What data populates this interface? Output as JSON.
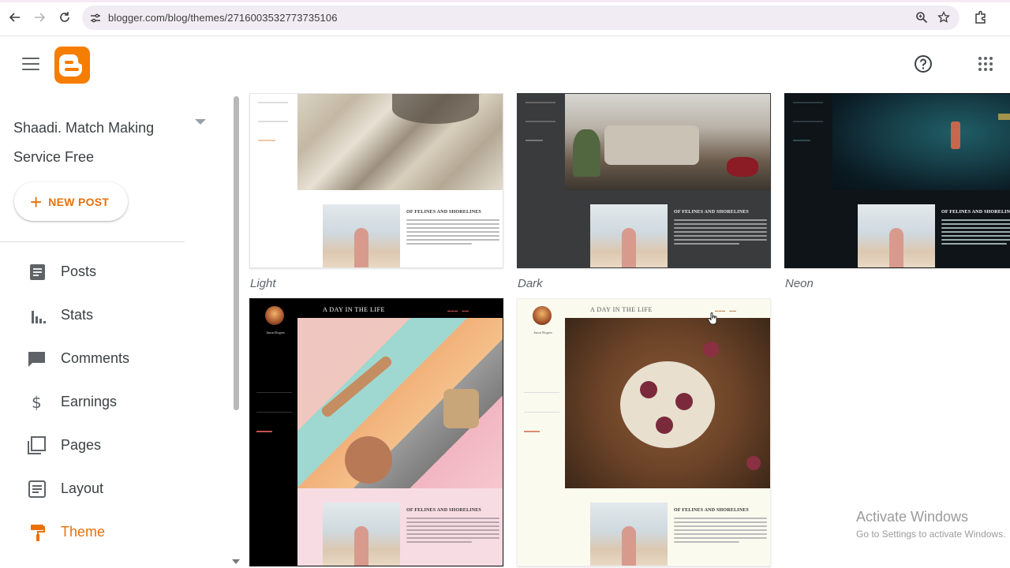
{
  "browser": {
    "url": "blogger.com/blog/themes/2716003532773735106"
  },
  "header": {
    "logo_name": "blogger-logo"
  },
  "sidebar": {
    "blog_name": "Shaadi. Match Making Service Free",
    "new_post_label": "NEW POST",
    "items": [
      {
        "label": "Posts",
        "icon": "posts-icon"
      },
      {
        "label": "Stats",
        "icon": "stats-icon"
      },
      {
        "label": "Comments",
        "icon": "comments-icon"
      },
      {
        "label": "Earnings",
        "icon": "earnings-icon"
      },
      {
        "label": "Pages",
        "icon": "pages-icon"
      },
      {
        "label": "Layout",
        "icon": "layout-icon"
      },
      {
        "label": "Theme",
        "icon": "theme-icon",
        "active": true
      }
    ]
  },
  "themes": [
    {
      "name": "Light"
    },
    {
      "name": "Dark"
    },
    {
      "name": "Neon"
    },
    {
      "name": ""
    },
    {
      "name": ""
    }
  ],
  "card_text": {
    "post_title": "OF FELINES AND SHORELINES",
    "blog_head": "A DAY IN THE LIFE",
    "author": "Jason Rogers"
  },
  "watermark": {
    "line1": "Activate Windows",
    "line2": "Go to Settings to activate Windows."
  },
  "colors": {
    "accent": "#e8710a",
    "blogger_orange": "#f57d00"
  }
}
